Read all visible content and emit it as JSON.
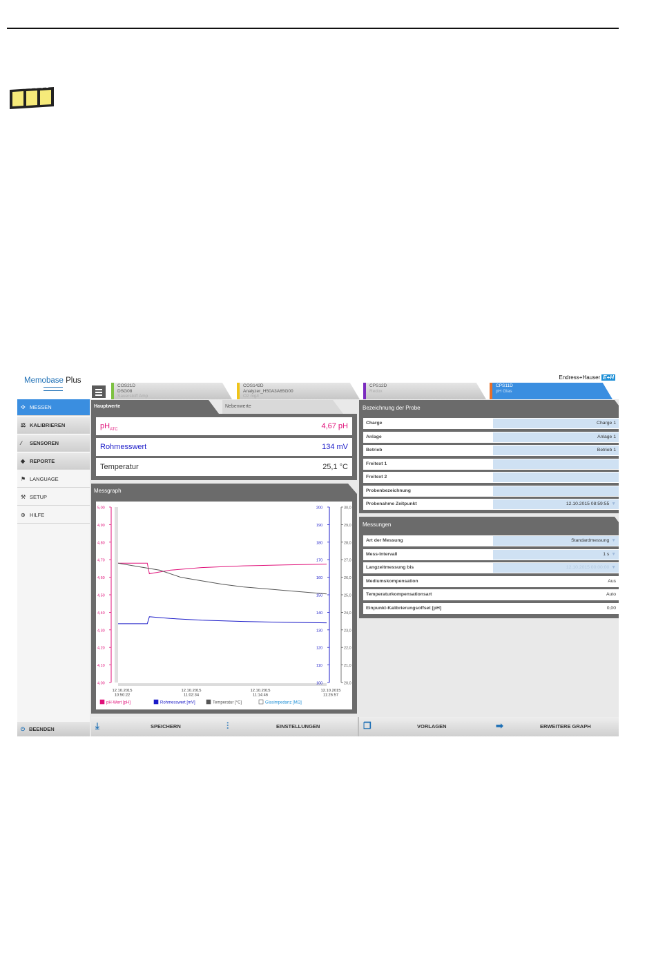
{
  "app": {
    "logo_name": "Memobase",
    "logo_suffix": "Plus",
    "brand": "Endress+Hauser",
    "brand_badge": "E+H"
  },
  "sensor_tabs": [
    {
      "line1": "COS21D",
      "line2": "DSG08",
      "line3": "Sauerstoff Amp",
      "color": "#7dc142",
      "active": false
    },
    {
      "line1": "COS142D",
      "line2": "Analyzer_H50A3A65G00",
      "line3": "O2 mg/l",
      "color": "#f0c419",
      "active": false
    },
    {
      "line1": "CPS12D",
      "line2": "Redox",
      "line3": "",
      "color": "#7b2cbf",
      "active": false
    },
    {
      "line1": "CPS11D",
      "line2": "pH Glas",
      "line3": "",
      "color": "#e8702a",
      "active": true
    }
  ],
  "sidebar": {
    "items": [
      {
        "label": "MESSEN",
        "icon": "✣"
      },
      {
        "label": "KALIBRIEREN",
        "icon": "⚖"
      },
      {
        "label": "SENSOREN",
        "icon": "∕"
      },
      {
        "label": "REPORTE",
        "icon": "◆"
      },
      {
        "label": "LANGUAGE",
        "icon": "⚑"
      },
      {
        "label": "SETUP",
        "icon": "⚒"
      },
      {
        "label": "HILFE",
        "icon": "⊕"
      }
    ],
    "exit_label": "BEENDEN"
  },
  "tabs": {
    "main": "Hauptwerte",
    "secondary": "Nebenwerte"
  },
  "main_values": [
    {
      "label": "pH",
      "sub": "ATC",
      "value": "4,67 pH",
      "color": "#e0127a"
    },
    {
      "label": "Rohmesswert",
      "sub": "",
      "value": "134 mV",
      "color": "#1a1ac8"
    },
    {
      "label": "Temperatur",
      "sub": "",
      "value": "25,1 °C",
      "color": "#333333"
    }
  ],
  "graph": {
    "title": "Messgraph",
    "legend": [
      {
        "label": "pH-Wert [pH]",
        "color": "#e0127a"
      },
      {
        "label": "Rohmesswert [mV]",
        "color": "#1a1ac8"
      },
      {
        "label": "Temperatur [°C]",
        "color": "#555555"
      },
      {
        "label": "Glasimpedanz [MΩ]",
        "color": "#1d8fd6"
      }
    ]
  },
  "chart_data": {
    "type": "line",
    "x": [
      "12.10.2015 10:50:22",
      "12.10.2015 11:02:34",
      "12.10.2015 11:14:46",
      "12.10.2015 11:26:57"
    ],
    "x_tick_dates": [
      "12.10.2015",
      "12.10.2015",
      "12.10.2015",
      "12.10.2015"
    ],
    "x_tick_times": [
      "10:50:22",
      "11:02:34",
      "11:14:46",
      "11:26:57"
    ],
    "y_ph_ticks": [
      "5,00",
      "4,90",
      "4,80",
      "4,70",
      "4,60",
      "4,50",
      "4,40",
      "4,30",
      "4,20",
      "4,10",
      "4,00"
    ],
    "y_mv_ticks": [
      "200",
      "190",
      "180",
      "170",
      "160",
      "150",
      "140",
      "130",
      "120",
      "110",
      "100"
    ],
    "y_temp_ticks": [
      "30,0",
      "29,0",
      "28,0",
      "27,0",
      "26,0",
      "25,0",
      "24,0",
      "23,0",
      "22,0",
      "21,0",
      "20,0"
    ],
    "ylim_ph": [
      4.0,
      5.0
    ],
    "ylim_mv": [
      100,
      200
    ],
    "ylim_temp": [
      20,
      30
    ],
    "series": [
      {
        "name": "pH-Wert [pH]",
        "axis": "ph",
        "color": "#e0127a",
        "points": [
          [
            0,
            4.68
          ],
          [
            0.1,
            4.68
          ],
          [
            0.14,
            4.68
          ],
          [
            0.15,
            4.62
          ],
          [
            0.25,
            4.64
          ],
          [
            0.4,
            4.655
          ],
          [
            0.6,
            4.665
          ],
          [
            0.8,
            4.67
          ],
          [
            1.0,
            4.675
          ]
        ]
      },
      {
        "name": "Rohmesswert [mV]",
        "axis": "mv",
        "color": "#1a1ac8",
        "points": [
          [
            0,
            133.5
          ],
          [
            0.14,
            133.5
          ],
          [
            0.15,
            137.5
          ],
          [
            0.25,
            136.5
          ],
          [
            0.4,
            135.5
          ],
          [
            0.6,
            134.8
          ],
          [
            0.8,
            134.3
          ],
          [
            1.0,
            134
          ]
        ]
      },
      {
        "name": "Temperatur [°C]",
        "axis": "temp",
        "color": "#555555",
        "points": [
          [
            0,
            26.8
          ],
          [
            0.1,
            26.6
          ],
          [
            0.2,
            26.4
          ],
          [
            0.3,
            26.0
          ],
          [
            0.4,
            25.8
          ],
          [
            0.5,
            25.6
          ],
          [
            0.6,
            25.45
          ],
          [
            0.7,
            25.35
          ],
          [
            0.8,
            25.25
          ],
          [
            0.9,
            25.15
          ],
          [
            1.0,
            25.05
          ]
        ]
      }
    ]
  },
  "probe": {
    "title": "Bezeichnung der Probe",
    "rows": [
      {
        "label": "Charge",
        "value": "Charge 1",
        "arrow": ""
      },
      {
        "label": "Anlage",
        "value": "Anlage 1",
        "arrow": ""
      },
      {
        "label": "Betrieb",
        "value": "Betrieb 1",
        "arrow": ""
      },
      {
        "label": "Freitext 1",
        "value": "",
        "arrow": ""
      },
      {
        "label": "Freitext 2",
        "value": "",
        "arrow": ""
      },
      {
        "label": "Probenbezeichnung",
        "value": "",
        "arrow": ""
      },
      {
        "label": "Probenahme Zeitpunkt",
        "value": "12.10.2015 08:59:55",
        "arrow": "▼"
      }
    ]
  },
  "measure": {
    "title": "Messungen",
    "rows": [
      {
        "label": "Art der Messung",
        "value": "Standardmessung",
        "arrow": "▼",
        "style": "field"
      },
      {
        "label": "Mess-Intervall",
        "value": "1 s",
        "arrow": "▼",
        "style": "field"
      },
      {
        "label": "Langzeitmessung bis",
        "value": "12.10.2015 00:00:00",
        "arrow": "▼",
        "style": "disabled"
      },
      {
        "label": "Mediumskompensation",
        "value": "Aus",
        "arrow": "",
        "style": "plain"
      },
      {
        "label": "Temperaturkompensationsart",
        "value": "Auto",
        "arrow": "",
        "style": "plain"
      },
      {
        "label": "Einpunkt-Kalibrierungsoffset [pH]",
        "value": "0,00",
        "arrow": "",
        "style": "plain"
      }
    ]
  },
  "toolbar": {
    "save": "SPEICHERN",
    "settings": "EINSTELLUNGEN",
    "templates": "VORLAGEN",
    "extended_graph": "ERWEITERE GRAPH"
  }
}
